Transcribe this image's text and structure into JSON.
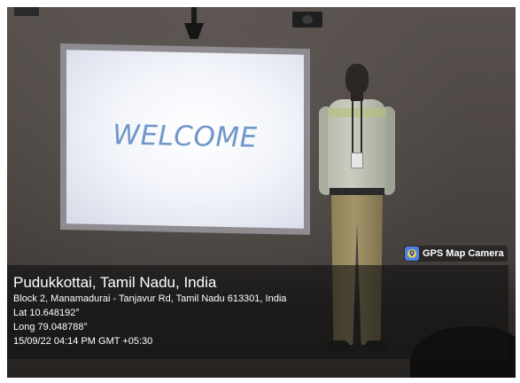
{
  "gps_badge": {
    "label": "GPS Map Camera",
    "icon": "map-pin-icon"
  },
  "location": {
    "city": "Pudukkottai, Tamil Nadu, India",
    "address": "Block 2, Manamadurai - Tanjavur Rd, Tamil Nadu 613301, India",
    "latitude": "Lat 10.648192°",
    "longitude": "Long 79.048788°",
    "timestamp": "15/09/22 04:14 PM GMT +05:30"
  },
  "screen": {
    "text": "WELCOME"
  },
  "colors": {
    "welcome_text": "#6f97c8",
    "overlay_bg": "#121212",
    "gps_icon": "#4d7ee8"
  }
}
